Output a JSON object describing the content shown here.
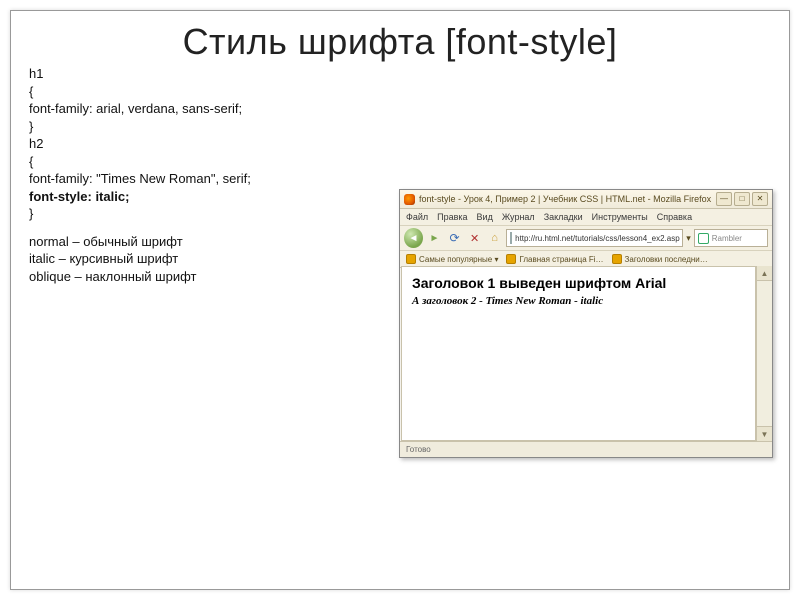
{
  "title": "Стиль шрифта [font-style]",
  "code": {
    "l1": "h1",
    "l2": "{",
    "l3": "font-family: arial, verdana, sans-serif;",
    "l4": "}",
    "l5": "h2",
    "l6": "{",
    "l7": "font-family: \"Times New Roman\", serif;",
    "l8": "font-style: italic;",
    "l9": "}"
  },
  "desc": {
    "l1": "normal – обычный шрифт",
    "l2": "italic – курсивный шрифт",
    "l3": "oblique – наклонный шрифт"
  },
  "browser": {
    "title": "font-style - Урок 4, Пример 2 | Учебник CSS | HTML.net - Mozilla Firefox",
    "menu": {
      "file": "Файл",
      "edit": "Правка",
      "view": "Вид",
      "history": "Журнал",
      "bookmarks": "Закладки",
      "tools": "Инструменты",
      "help": "Справка"
    },
    "nav": {
      "back": "◄",
      "fwd": "►",
      "reload": "⟳",
      "stop": "✕",
      "home": "⌂"
    },
    "url": "http://ru.html.net/tutorials/css/lesson4_ex2.asp",
    "url_dd": "▾",
    "search_placeholder": "Rambler",
    "bookmarks": {
      "popular": "Самые популярные ▾",
      "home": "Главная страница Fi…",
      "headlines": "Заголовки последни…"
    },
    "content": {
      "h1": "Заголовок 1 выведен шрифтом Arial",
      "h2": "А заголовок 2 - Times New Roman - italic"
    },
    "scroll": {
      "up": "▲",
      "dn": "▼"
    },
    "status": "Готово"
  }
}
